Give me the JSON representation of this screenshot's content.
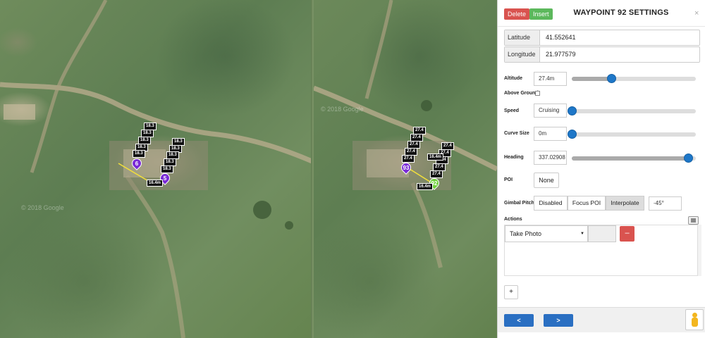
{
  "panel": {
    "title": "WAYPOINT 92 SETTINGS",
    "delete_label": "Delete",
    "insert_label": "Insert",
    "close_symbol": "×"
  },
  "coordinates": {
    "latitude_label": "Latitude",
    "latitude_value": "41.552641",
    "longitude_label": "Longitude",
    "longitude_value": "21.977579"
  },
  "altitude": {
    "label": "Altitude",
    "value": "27.4m",
    "slider_fraction": 0.32
  },
  "above_ground": {
    "label": "Above Ground",
    "checked": false
  },
  "speed": {
    "label": "Speed",
    "value": "Cruising",
    "slider_fraction": 0.0
  },
  "curve_size": {
    "label": "Curve Size",
    "value": "0m",
    "slider_fraction": 0.0
  },
  "heading": {
    "label": "Heading",
    "value": "337.02908",
    "slider_fraction": 0.94
  },
  "poi": {
    "label": "POI",
    "value": "None"
  },
  "gimbal_pitch": {
    "label": "Gimbal Pitch",
    "options": [
      "Disabled",
      "Focus POI",
      "Interpolate"
    ],
    "selected": "Interpolate",
    "value": "-45°"
  },
  "actions": {
    "label": "Actions",
    "items": [
      {
        "type": "Take Photo",
        "remove_symbol": "–"
      }
    ],
    "add_symbol": "+"
  },
  "footer": {
    "prev_symbol": "<",
    "next_symbol": ">"
  },
  "icons": {
    "close": "close-icon",
    "checkbox": "checkbox-icon",
    "photo": "photo-icon",
    "caret": "chevron-down-icon",
    "pegman": "street-view-pegman-icon"
  },
  "colors": {
    "delete": "#d9534f",
    "insert": "#5cb85c",
    "slider_knob": "#1e77c8",
    "nav_button": "#2a6fc2",
    "waypoint_purple": "#7a2bd6",
    "waypoint_selected": "#6fd13a",
    "path_yellow": "#f3e03a",
    "camera_cyan": "#25b8d9"
  },
  "map_left": {
    "watermark": "© 2018 Google",
    "altitude_labels": [
      "18.3",
      "18.3",
      "18.3",
      "18.3",
      "18.3",
      "18.3",
      "18.3",
      "18.3",
      "18.3",
      "18.3",
      "18.3"
    ],
    "waypoint_numbers": [
      "6",
      "5"
    ],
    "distance_label": "16.4m"
  },
  "map_right": {
    "watermark": "© 2018 Google",
    "altitude_labels": [
      "27.4",
      "27.4",
      "27.4",
      "27.4",
      "27.4",
      "27.4",
      "27.4",
      "27.4",
      "27.4",
      "27.4",
      "27.4",
      "27.4"
    ],
    "waypoint_numbers": [
      "93",
      "92"
    ],
    "distance_labels": [
      "16.4m",
      "16.4m"
    ]
  }
}
